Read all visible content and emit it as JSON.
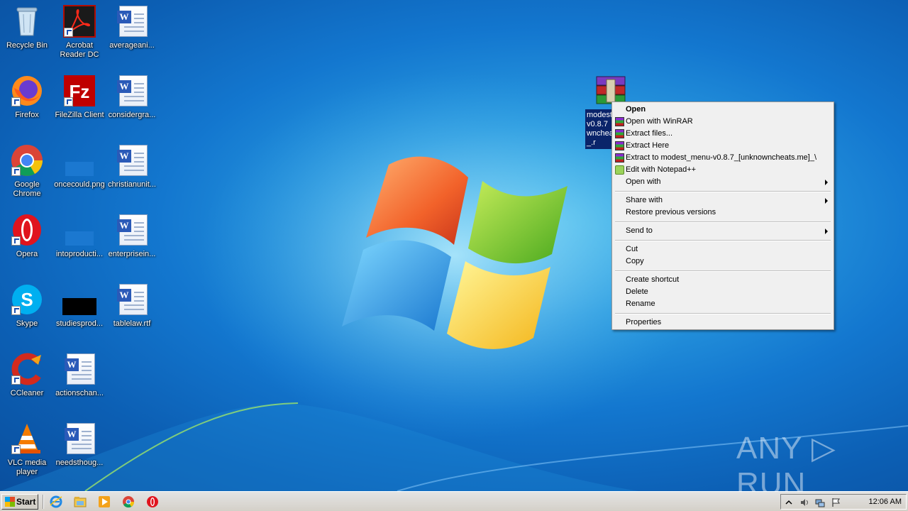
{
  "desktop": {
    "icons": [
      {
        "label": "Recycle Bin"
      },
      {
        "label": "Acrobat Reader DC"
      },
      {
        "label": "averageani..."
      },
      {
        "label": "Firefox"
      },
      {
        "label": "FileZilla Client"
      },
      {
        "label": "considergra..."
      },
      {
        "label": "Google Chrome"
      },
      {
        "label": "oncecould.png"
      },
      {
        "label": "christianunit..."
      },
      {
        "label": "Opera"
      },
      {
        "label": "intoproducti..."
      },
      {
        "label": "enterprisein..."
      },
      {
        "label": "Skype"
      },
      {
        "label": "studiesprod..."
      },
      {
        "label": "tablelaw.rtf"
      },
      {
        "label": "CCleaner"
      },
      {
        "label": "actionschan..."
      },
      {
        "label": "VLC media player"
      },
      {
        "label": "needsthoug..."
      }
    ],
    "selected_file": {
      "label": "modest_menu-v0.8.7_[unknowncheats.me]_.rar",
      "label_visible": "modest v0.8.7 wnchea _.r"
    }
  },
  "context_menu": {
    "items": [
      {
        "label": "Open",
        "bold": true
      },
      {
        "label": "Open with WinRAR",
        "icon": "winrar-icon"
      },
      {
        "label": "Extract files...",
        "icon": "winrar-icon"
      },
      {
        "label": "Extract Here",
        "icon": "winrar-icon"
      },
      {
        "label": "Extract to modest_menu-v0.8.7_[unknowncheats.me]_\\",
        "icon": "winrar-icon"
      },
      {
        "label": "Edit with Notepad++",
        "icon": "notepadpp-icon"
      },
      {
        "label": "Open with",
        "submenu": true
      },
      {
        "label": "Share with",
        "submenu": true
      },
      {
        "label": "Restore previous versions"
      },
      {
        "label": "Send to",
        "submenu": true
      },
      {
        "label": "Cut"
      },
      {
        "label": "Copy"
      },
      {
        "label": "Create shortcut"
      },
      {
        "label": "Delete"
      },
      {
        "label": "Rename"
      },
      {
        "label": "Properties"
      }
    ]
  },
  "taskbar": {
    "start_label": "Start",
    "clock": "12:06 AM"
  },
  "watermark": "ANY ▷ RUN",
  "colors": {
    "desktop": "#1a6fc2",
    "selection": "#0a246a",
    "menu_bg": "#f0f0f0",
    "taskbar": "#d4d0c8"
  }
}
